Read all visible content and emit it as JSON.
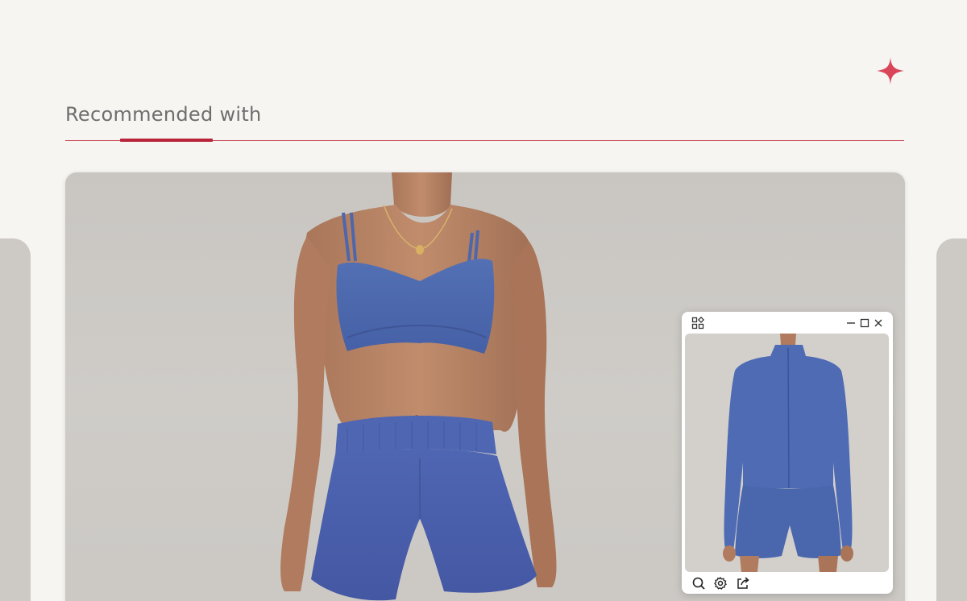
{
  "section": {
    "title": "Recommended with"
  },
  "colors": {
    "accent": "#b8243a",
    "rule": "#c94a55",
    "sparkle": "#d9465a",
    "garment": "#4a64ab",
    "background": "#f7f5f2"
  },
  "mini_window": {
    "toolbar_icons": [
      "apps-grid-icon",
      "minimize-icon",
      "maximize-icon",
      "close-icon"
    ],
    "footer_icons": [
      "search-icon",
      "settings-icon",
      "share-icon"
    ]
  }
}
